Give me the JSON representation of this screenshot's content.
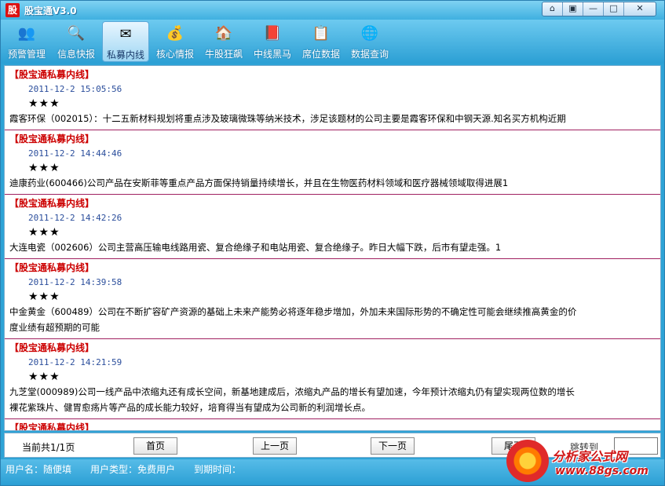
{
  "window": {
    "logo_char": "股",
    "title": "股宝通V3.0",
    "controls": [
      "⌂",
      "▣",
      "—",
      "□",
      "✕"
    ]
  },
  "toolbar": [
    {
      "label": "预警管理",
      "icon": "users-icon",
      "glyph": "👥",
      "active": false
    },
    {
      "label": "信息快报",
      "icon": "magnifier-icon",
      "glyph": "🔍",
      "active": false
    },
    {
      "label": "私募内线",
      "icon": "envelope-icon",
      "glyph": "✉",
      "active": true
    },
    {
      "label": "核心情报",
      "icon": "coins-icon",
      "glyph": "💰",
      "active": false
    },
    {
      "label": "牛股狂飙",
      "icon": "house-icon",
      "glyph": "🏠",
      "active": false
    },
    {
      "label": "中线黑马",
      "icon": "book-icon",
      "glyph": "📕",
      "active": false
    },
    {
      "label": "席位数据",
      "icon": "clipboard-icon",
      "glyph": "📋",
      "active": false
    },
    {
      "label": "数据查询",
      "icon": "globe-icon",
      "glyph": "🌐",
      "active": false
    }
  ],
  "items": [
    {
      "source": "【股宝通私募内线】",
      "time": "2011-12-2  15:05:56",
      "stars": "★★★",
      "text": "霞客环保（002015）：十二五新材料规划将重点涉及玻璃微珠等纳米技术，涉足该题材的公司主要是霞客环保和中钢天源.知名买方机构近期",
      "text2": ""
    },
    {
      "source": "【股宝通私募内线】",
      "time": "2011-12-2  14:44:46",
      "stars": "★★★",
      "text": "迪康药业(600466)公司产品在安斯菲等重点产品方面保持销量持续增长，并且在生物医药材料领域和医疗器械领域取得进展1",
      "text2": ""
    },
    {
      "source": "【股宝通私募内线】",
      "time": "2011-12-2  14:42:26",
      "stars": "★★★",
      "text": "大连电瓷（002606）公司主营高压输电线路用瓷、复合绝缘子和电站用瓷、复合绝缘子。昨日大幅下跌，后市有望走强。1",
      "text2": ""
    },
    {
      "source": "【股宝通私募内线】",
      "time": "2011-12-2  14:39:58",
      "stars": "★★★",
      "text": "中金黄金（600489）公司在不断扩容矿产资源的基础上未来产能势必将逐年稳步增加，外加未来国际形势的不确定性可能会继续推高黄金的价",
      "text2": "度业绩有超预期的可能"
    },
    {
      "source": "【股宝通私募内线】",
      "time": "2011-12-2  14:21:59",
      "stars": "★★★",
      "text": "九芝堂(000989)公司一线产品中浓缩丸还有成长空间，新基地建成后，浓缩丸产品的增长有望加速，今年预计浓缩丸仍有望实现两位数的增长",
      "text2": "裸花紫珠片、健胃愈疡片等产品的成长能力较好，培育得当有望成为公司新的利润增长点。"
    },
    {
      "source": "【股宝通私募内线】",
      "time": "",
      "stars": "",
      "text": "",
      "text2": ""
    }
  ],
  "pager": {
    "status": "当前共1/1页",
    "first": "首页",
    "prev": "上一页",
    "next": "下一页",
    "last": "尾页",
    "jump_label": "跳转到"
  },
  "statusbar": {
    "user_label": "用户名：随便填",
    "type_label": "用户类型：免费用户",
    "expire_label": "到期时间："
  },
  "watermark": {
    "line1": "分析家公式网",
    "line2": "www.88gs.com"
  }
}
